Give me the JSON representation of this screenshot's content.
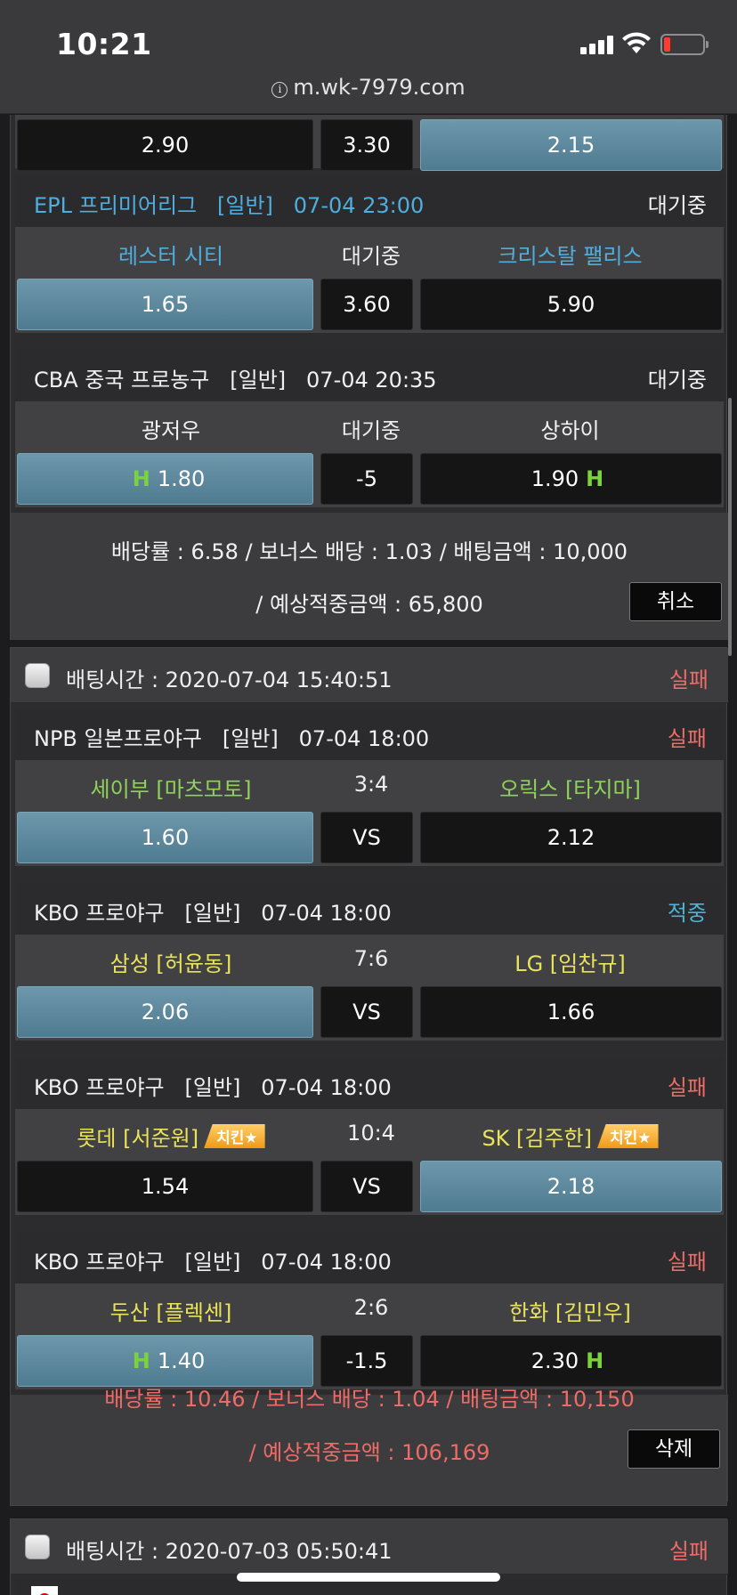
{
  "status": {
    "time": "10:21",
    "url": "m.wk-7979.com"
  },
  "top_odds": {
    "home": "2.90",
    "mid": "3.30",
    "away": "2.15",
    "selected": "away"
  },
  "bet1": {
    "games": [
      {
        "league": "EPL 프리미어리그   [일반]   07-04 23:00",
        "status": "대기중",
        "home": "레스터 시티",
        "mid": "대기중",
        "away": "크리스탈 팰리스",
        "odd_home": "1.65",
        "odd_mid": "3.60",
        "odd_away": "5.90",
        "selected": "home"
      },
      {
        "league": "CBA 중국 프로농구   [일반]   07-04 20:35",
        "status": "대기중",
        "home": "광저우",
        "mid": "대기중",
        "away": "상하이",
        "odd_home": "1.80",
        "odd_mid": "-5",
        "odd_away": "1.90",
        "selected": "home",
        "h_mark": "H"
      }
    ],
    "summary_line1": "배당률 : 6.58 / 보너스 배당 : 1.03 / 배팅금액 : 10,000",
    "summary_line2": "/ 예상적중금액 : 65,800",
    "button": "취소"
  },
  "bet2": {
    "time": "배팅시간 : 2020-07-04 15:40:51",
    "status": "실패",
    "games": [
      {
        "league": "NPB 일본프로야구   [일반]   07-04 18:00",
        "status": "실패",
        "home": "세이부 [마츠모토]",
        "mid": "3:4",
        "away": "오릭스 [타지마]",
        "odd_home": "1.60",
        "odd_mid": "VS",
        "odd_away": "2.12",
        "selected": "home"
      },
      {
        "league": "KBO 프로야구   [일반]   07-04 18:00",
        "status": "적중",
        "home": "삼성 [허윤동]",
        "mid": "7:6",
        "away": "LG [임찬규]",
        "odd_home": "2.06",
        "odd_mid": "VS",
        "odd_away": "1.66",
        "selected": "home"
      },
      {
        "league": "KBO 프로야구   [일반]   07-04 18:00",
        "status": "실패",
        "home": "롯데 [서준원]",
        "home_badge": "치킨★",
        "mid": "10:4",
        "away": "SK [김주한]",
        "away_badge": "치킨★",
        "odd_home": "1.54",
        "odd_mid": "VS",
        "odd_away": "2.18",
        "selected": "away"
      },
      {
        "league": "KBO 프로야구   [일반]   07-04 18:00",
        "status": "실패",
        "home": "두산 [플렉센]",
        "mid": "2:6",
        "away": "한화 [김민우]",
        "odd_home": "1.40",
        "odd_mid": "-1.5",
        "odd_away": "2.30",
        "selected": "home",
        "h_mark": "H"
      }
    ],
    "summary_line1": "배당률 : 10.46 / 보너스 배당 : 1.04 / 배팅금액 : 10,150",
    "summary_line2": "/ 예상적중금액 : 106,169",
    "button": "삭제"
  },
  "bet3": {
    "time": "배팅시간 : 2020-07-03 05:50:41",
    "status": "실패"
  },
  "colors": {
    "selected_odd": "#5a8aa0",
    "fail": "#ee6b66",
    "hit": "#4bb5d6",
    "pending": "#f2f2f2",
    "h_mark": "#7bd23c"
  }
}
